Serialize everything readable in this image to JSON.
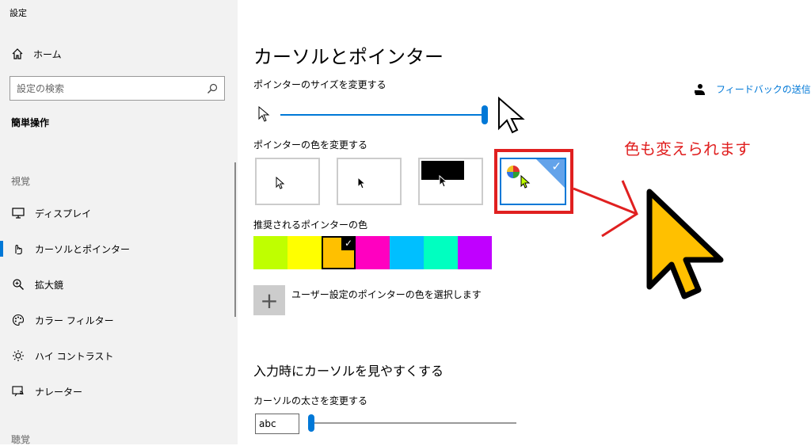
{
  "app": {
    "title": "設定"
  },
  "sidebar": {
    "home": "ホーム",
    "search_placeholder": "設定の検索",
    "current_section": "簡単操作",
    "group_vision": "視覚",
    "items": [
      {
        "label": "ディスプレイ",
        "icon": "monitor-icon"
      },
      {
        "label": "カーソルとポインター",
        "icon": "pointer-hand-icon",
        "active": true
      },
      {
        "label": "拡大鏡",
        "icon": "magnifier-icon"
      },
      {
        "label": "カラー フィルター",
        "icon": "palette-icon"
      },
      {
        "label": "ハイ コントラスト",
        "icon": "brightness-icon"
      },
      {
        "label": "ナレーター",
        "icon": "narrator-icon"
      }
    ],
    "group_hearing": "聴覚"
  },
  "main": {
    "title": "カーソルとポインター",
    "size_label": "ポインターのサイズを変更する",
    "size_level": 1.0,
    "color_label": "ポインターの色を変更する",
    "color_options": [
      "white",
      "black",
      "inverted",
      "custom"
    ],
    "selected_color_option": "custom",
    "recommended_label": "推奨されるポインターの色",
    "swatches": [
      "#bfff00",
      "#ffff00",
      "#ffc000",
      "#ff00c0",
      "#00bfff",
      "#00ffc0",
      "#c000ff"
    ],
    "selected_swatch": 2,
    "custom_color_label": "ユーザー設定のポインターの色を選択します",
    "visibility_heading": "入力時にカーソルを見やすくする",
    "thickness_label": "カーソルの太さを変更する",
    "thickness_preview": "abc",
    "thickness_level": 0.0
  },
  "help": {
    "feedback": "フィードバックの送信"
  },
  "annotation": {
    "text": "色も変えられます",
    "color": "#e02020"
  },
  "colors": {
    "accent": "#0078d7",
    "cursor_yellow": "#ffc000"
  }
}
